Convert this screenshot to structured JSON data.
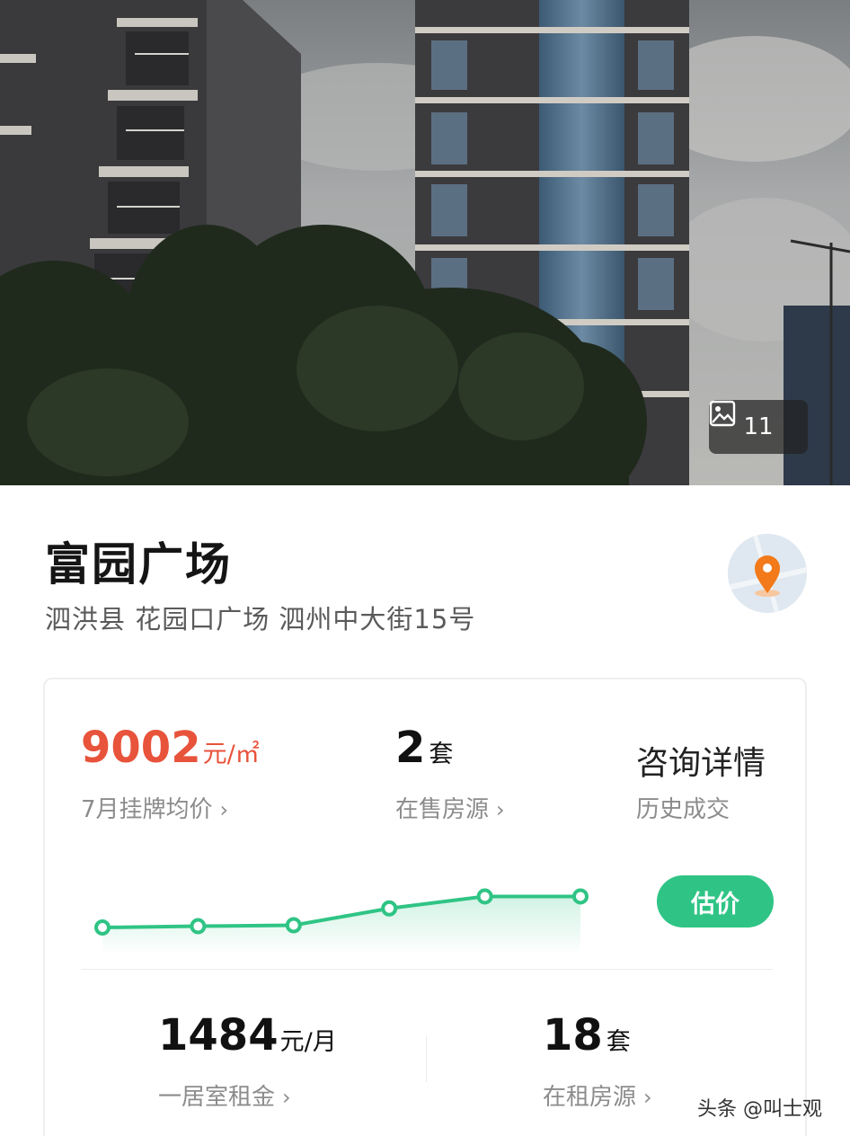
{
  "hero": {
    "photo_count": "11",
    "photo_icon": "image-icon"
  },
  "community": {
    "name": "富园广场",
    "address": "泗洪县 花园口广场 泗州中大街15号",
    "map_icon": "location-pin-icon"
  },
  "stats": {
    "avg_price_value": "9002",
    "avg_price_unit": "元/㎡",
    "avg_price_label": "7月挂牌均价",
    "for_sale_value": "2",
    "for_sale_unit": "套",
    "for_sale_label": "在售房源",
    "consult_label": "咨询详情",
    "history_label": "历史成交",
    "estimate_button": "估价",
    "rent_value": "1484",
    "rent_unit": "元/月",
    "rent_label": "一居室租金",
    "for_rent_value": "18",
    "for_rent_unit": "套",
    "for_rent_label": "在租房源",
    "chevron": "›"
  },
  "chart_data": {
    "type": "line",
    "points": 6,
    "relative_values": [
      0.0,
      0.04,
      0.07,
      0.59,
      0.96,
      0.96
    ],
    "color": "#2fc485"
  },
  "watermark": "头条 @叫士观",
  "colors": {
    "accent_green": "#2fc485",
    "price_red": "#e8533b",
    "pin_orange": "#f27a1a"
  }
}
